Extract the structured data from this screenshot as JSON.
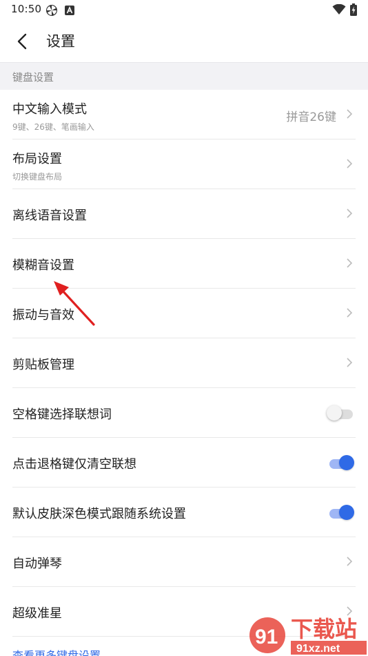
{
  "status_bar": {
    "time": "10:50",
    "icons": [
      "pinwheel-icon",
      "a-icon",
      "wifi-icon",
      "battery-charging-icon"
    ]
  },
  "header": {
    "title": "设置",
    "back_icon": "chevron-left-icon"
  },
  "section": {
    "title": "键盘设置"
  },
  "rows": [
    {
      "label": "中文输入模式",
      "sub": "9键、26键、笔画输入",
      "value": "拼音26键"
    },
    {
      "label": "布局设置",
      "sub": "切换键盘布局"
    },
    {
      "label": "离线语音设置"
    },
    {
      "label": "模糊音设置"
    },
    {
      "label": "振动与音效"
    },
    {
      "label": "剪贴板管理"
    },
    {
      "label": "空格键选择联想词",
      "toggle": false
    },
    {
      "label": "点击退格键仅清空联想",
      "toggle": true
    },
    {
      "label": "默认皮肤深色模式跟随系统设置",
      "toggle": true
    },
    {
      "label": "自动弹琴"
    },
    {
      "label": "超级准星"
    }
  ],
  "footer": {
    "link": "查看更多键盘设置"
  },
  "colors": {
    "accent": "#2f6ae6",
    "section_bg": "#f2f2f5",
    "annotation": "#e02020"
  },
  "watermark": {
    "text": "下载站",
    "sub": "91xz.net"
  }
}
